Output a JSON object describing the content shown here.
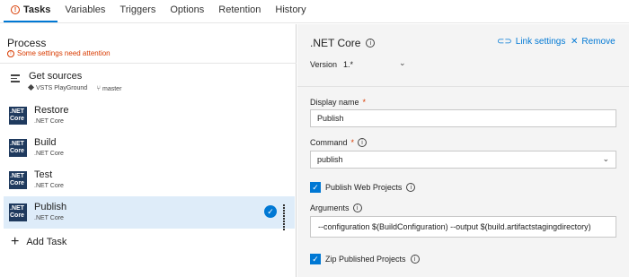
{
  "tabs": [
    {
      "label": "Tasks",
      "active": true,
      "warning_icon": "warning-circle-icon"
    },
    {
      "label": "Variables"
    },
    {
      "label": "Triggers"
    },
    {
      "label": "Options"
    },
    {
      "label": "Retention"
    },
    {
      "label": "History"
    }
  ],
  "process": {
    "title": "Process",
    "attention": "Some settings need attention"
  },
  "get_sources": {
    "title": "Get sources",
    "repo": "VSTS PlayGround",
    "branch": "master"
  },
  "tasks": [
    {
      "title": "Restore",
      "sub": ".NET Core",
      "icon_line1": ".NET",
      "icon_line2": "Core"
    },
    {
      "title": "Build",
      "sub": ".NET Core",
      "icon_line1": ".NET",
      "icon_line2": "Core"
    },
    {
      "title": "Test",
      "sub": ".NET Core",
      "icon_line1": ".NET",
      "icon_line2": "Core"
    },
    {
      "title": "Publish",
      "sub": ".NET Core",
      "icon_line1": ".NET",
      "icon_line2": "Core",
      "selected": true
    }
  ],
  "add_task": "Add Task",
  "details": {
    "title": ".NET Core",
    "link_settings": "Link settings",
    "remove": "Remove",
    "version_label": "Version",
    "version_value": "1.*",
    "display_name_label": "Display name",
    "display_name_value": "Publish",
    "command_label": "Command",
    "command_value": "publish",
    "publish_web_projects": "Publish Web Projects",
    "arguments_label": "Arguments",
    "arguments_value": "--configuration $(BuildConfiguration) --output $(build.artifactstagingdirectory)",
    "zip_published_projects": "Zip Published Projects",
    "required_mark": "*"
  },
  "colors": {
    "accent": "#0078d4",
    "warning": "#d83b01",
    "selected_bg": "#deecf9",
    "dotnet_icon_bg": "#1f3a5e"
  }
}
